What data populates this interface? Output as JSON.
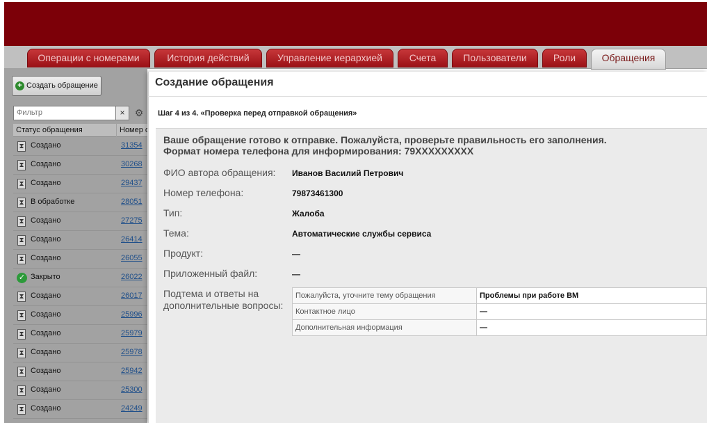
{
  "tabs": [
    {
      "label": "Операции с номерами"
    },
    {
      "label": "История действий"
    },
    {
      "label": "Управление иерархией"
    },
    {
      "label": "Счета"
    },
    {
      "label": "Пользователи"
    },
    {
      "label": "Роли"
    },
    {
      "label": "Обращения",
      "active": true
    }
  ],
  "sidebar": {
    "create_button": "Создать обращение",
    "filter_placeholder": "Фильтр",
    "filter_clear": "×",
    "columns": {
      "status": "Статус обращения",
      "number": "Номер о"
    },
    "rows": [
      {
        "status": "Создано",
        "icon": "hourglass-icon",
        "number": "31354"
      },
      {
        "status": "Создано",
        "icon": "hourglass-icon",
        "number": "30268"
      },
      {
        "status": "Создано",
        "icon": "hourglass-icon",
        "number": "29437"
      },
      {
        "status": "В обработке",
        "icon": "hourglass-icon",
        "number": "28051"
      },
      {
        "status": "Создано",
        "icon": "hourglass-icon",
        "number": "27275"
      },
      {
        "status": "Создано",
        "icon": "hourglass-icon",
        "number": "26414"
      },
      {
        "status": "Создано",
        "icon": "hourglass-icon",
        "number": "26055"
      },
      {
        "status": "Закрыто",
        "icon": "checkmark-icon",
        "number": "26022"
      },
      {
        "status": "Создано",
        "icon": "hourglass-icon",
        "number": "26017"
      },
      {
        "status": "Создано",
        "icon": "hourglass-icon",
        "number": "25996"
      },
      {
        "status": "Создано",
        "icon": "hourglass-icon",
        "number": "25979"
      },
      {
        "status": "Создано",
        "icon": "hourglass-icon",
        "number": "25978"
      },
      {
        "status": "Создано",
        "icon": "hourglass-icon",
        "number": "25942"
      },
      {
        "status": "Создано",
        "icon": "hourglass-icon",
        "number": "25300"
      },
      {
        "status": "Создано",
        "icon": "hourglass-icon",
        "number": "24249"
      }
    ]
  },
  "modal": {
    "title": "Создание обращения",
    "step": "Шаг 4 из 4. «Проверка перед отправкой обращения»",
    "intro_line1": "Ваше обращение готово к отправке. Пожалуйста, проверьте правильность его заполнения.",
    "intro_line2": "Формат номера телефона для информирования: 79XXXXXXXXX",
    "fields": [
      {
        "label": "ФИО автора обращения:",
        "value": "Иванов Василий Петрович"
      },
      {
        "label": "Номер телефона:",
        "value": "79873461300"
      },
      {
        "label": "Тип:",
        "value": "Жалоба"
      },
      {
        "label": "Тема:",
        "value": "Автоматические службы сервиса"
      },
      {
        "label": "Продукт:",
        "value": "—"
      },
      {
        "label": "Приложенный файл:",
        "value": "—"
      }
    ],
    "subtopics_label": "Подтема и ответы на дополнительные вопросы:",
    "subtopics": [
      {
        "question": "Пожалуйста, уточните тему обращения",
        "answer": "Проблемы при работе ВМ"
      },
      {
        "question": "Контактное лицо",
        "answer": "—"
      },
      {
        "question": "Дополнительная информация",
        "answer": "—"
      }
    ]
  }
}
